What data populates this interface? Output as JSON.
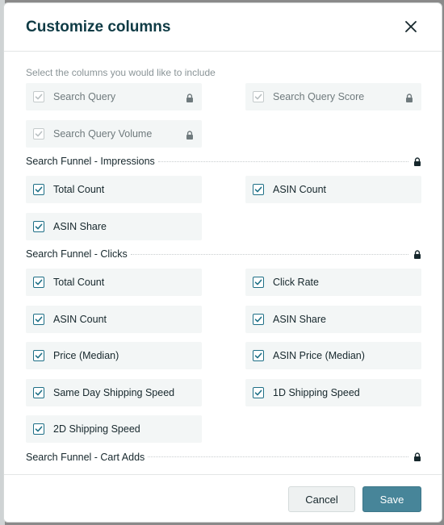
{
  "dialog": {
    "title": "Customize columns",
    "instructions": "Select the columns you would like to include"
  },
  "base_columns": [
    {
      "label": "Search Query",
      "checked": true,
      "locked": true
    },
    {
      "label": "Search Query Score",
      "checked": true,
      "locked": true
    },
    {
      "label": "Search Query Volume",
      "checked": true,
      "locked": true
    }
  ],
  "sections": [
    {
      "title": "Search Funnel - Impressions",
      "options": [
        {
          "label": "Total Count",
          "checked": true
        },
        {
          "label": "ASIN Count",
          "checked": true
        },
        {
          "label": "ASIN Share",
          "checked": true
        }
      ]
    },
    {
      "title": "Search Funnel - Clicks",
      "options": [
        {
          "label": "Total Count",
          "checked": true
        },
        {
          "label": "Click Rate",
          "checked": true
        },
        {
          "label": "ASIN Count",
          "checked": true
        },
        {
          "label": "ASIN Share",
          "checked": true
        },
        {
          "label": "Price (Median)",
          "checked": true
        },
        {
          "label": "ASIN Price (Median)",
          "checked": true
        },
        {
          "label": "Same Day Shipping Speed",
          "checked": true
        },
        {
          "label": "1D Shipping Speed",
          "checked": true
        },
        {
          "label": "2D Shipping Speed",
          "checked": true
        }
      ]
    },
    {
      "title": "Search Funnel - Cart Adds",
      "options": []
    }
  ],
  "footer": {
    "cancel_label": "Cancel",
    "save_label": "Save"
  },
  "colors": {
    "accent": "#478599",
    "checkbox": "#1e6f86",
    "title": "#0f3b45"
  }
}
